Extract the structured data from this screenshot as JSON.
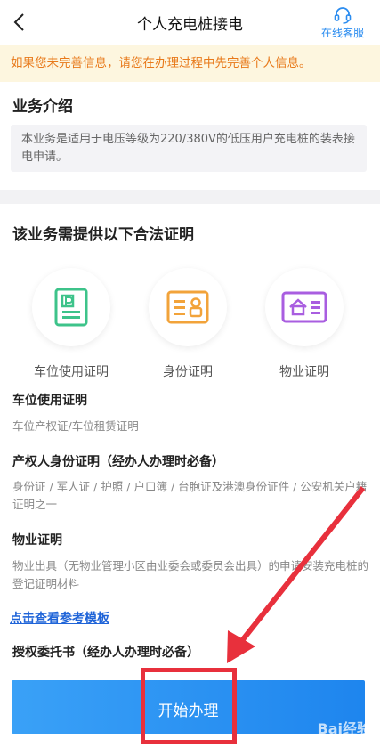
{
  "header": {
    "title": "个人充电桩接电",
    "service_label": "在线客服"
  },
  "notice": {
    "text": "如果您未完善信息，请您在办理过程中先完善个人信息。"
  },
  "intro": {
    "title": "业务介绍",
    "text": "本业务是适用于电压等级为220/380V的低压用户充电桩的装表接电申请。"
  },
  "docs": {
    "title": "该业务需提供以下合法证明",
    "icons": [
      {
        "label": "车位使用证明",
        "color": "#3dc38a"
      },
      {
        "label": "身份证明",
        "color": "#f2a33a"
      },
      {
        "label": "物业证明",
        "color": "#a95ee0"
      }
    ],
    "requirements": [
      {
        "title": "车位使用证明",
        "desc": "车位产权证/车位租赁证明"
      },
      {
        "title": "产权人身份证明（经办人办理时必备）",
        "desc": "身份证 / 军人证 / 护照 / 户口簿 / 台胞证及港澳身份证件 / 公安机关户籍证明之一"
      },
      {
        "title": "物业证明",
        "desc": "物业出具（无物业管理小区由业委会或委员会出具）的申请安装充电桩的登记证明材料"
      }
    ],
    "link_text": "点击查看参考模板",
    "auth_title": "授权委托书（经办人办理时必备）"
  },
  "action": {
    "start_label": "开始办理"
  },
  "watermark": "Bai经验",
  "colors": {
    "accent": "#2a8cf0",
    "notice_text": "#e8791a",
    "annotation": "#e8303c"
  }
}
